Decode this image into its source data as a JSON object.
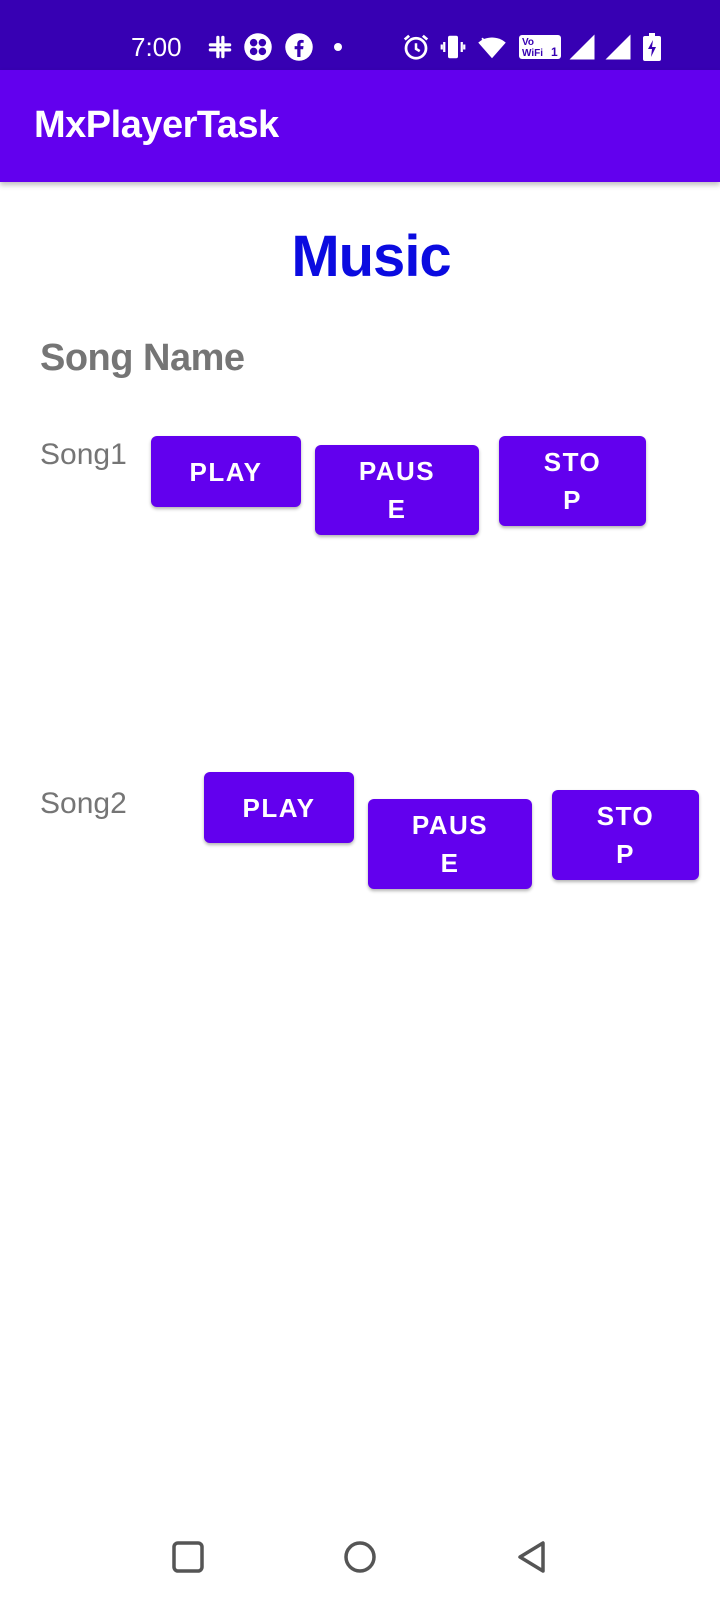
{
  "status_bar": {
    "time": "7:00",
    "icons": [
      "slack-icon",
      "app-grid-icon",
      "facebook-icon",
      "notification-dot-icon",
      "alarm-icon",
      "vibrate-icon",
      "wifi-icon",
      "vowifi-icon",
      "signal-icon",
      "signal-icon",
      "battery-charging-icon"
    ]
  },
  "app_bar": {
    "title": "MxPlayerTask"
  },
  "main": {
    "heading": "Music",
    "section_title": "Song Name",
    "songs": [
      {
        "name": "Song1",
        "play_label": "PLAY",
        "pause_label_line1": "PAUS",
        "pause_label_line2": "E",
        "stop_label_line1": "STO",
        "stop_label_line2": "P"
      },
      {
        "name": "Song2",
        "play_label": "PLAY",
        "pause_label_line1": "PAUS",
        "pause_label_line2": "E",
        "stop_label_line1": "STO",
        "stop_label_line2": "P"
      }
    ]
  },
  "nav_bar": {
    "buttons": [
      "recents-icon",
      "home-icon",
      "back-icon"
    ]
  },
  "colors": {
    "status_bar": "#3700b3",
    "app_bar": "#6200ee",
    "button": "#6200ee",
    "heading": "#0b0be0",
    "label": "#757575"
  }
}
